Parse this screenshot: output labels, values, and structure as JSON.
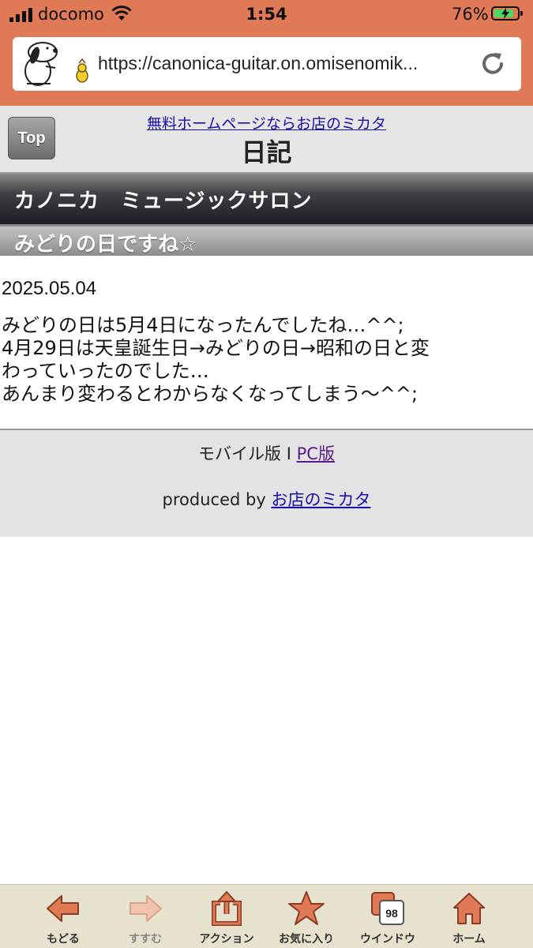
{
  "status_bar": {
    "carrier": "docomo",
    "time": "1:54",
    "battery_percent": "76%",
    "battery_level": 0.76
  },
  "browser": {
    "url": "https://canonica-guitar.on.omisenomik..."
  },
  "header": {
    "top_button": "Top",
    "ad_link": "無料ホームページならお店のミカタ",
    "title": "日記"
  },
  "shop": {
    "name": "カノニカ　ミュージックサロン"
  },
  "article": {
    "title": "みどりの日ですね☆",
    "date": "2025.05.04",
    "lines": [
      "みどりの日は5月4日になったんでしたね…^^;",
      "4月29日は天皇誕生日→みどりの日→昭和の日と変",
      "わっていったのでした…",
      "あんまり変わるとわからなくなってしまう〜^^;"
    ]
  },
  "footer": {
    "mobile_label": "モバイル版",
    "separator": "I",
    "pc_link": "PC版",
    "produced_by": "produced by",
    "produced_link": "お店のミカタ"
  },
  "toolbar": {
    "back": "もどる",
    "forward": "すすむ",
    "action": "アクション",
    "favorites": "お気に入り",
    "window": "ウインドウ",
    "window_count": "98",
    "home": "ホーム"
  },
  "colors": {
    "browser_chrome": "#e07a56",
    "toolbar_icon": "#e07a56",
    "link": "#1a0dab",
    "visited_link": "#551a8b"
  }
}
